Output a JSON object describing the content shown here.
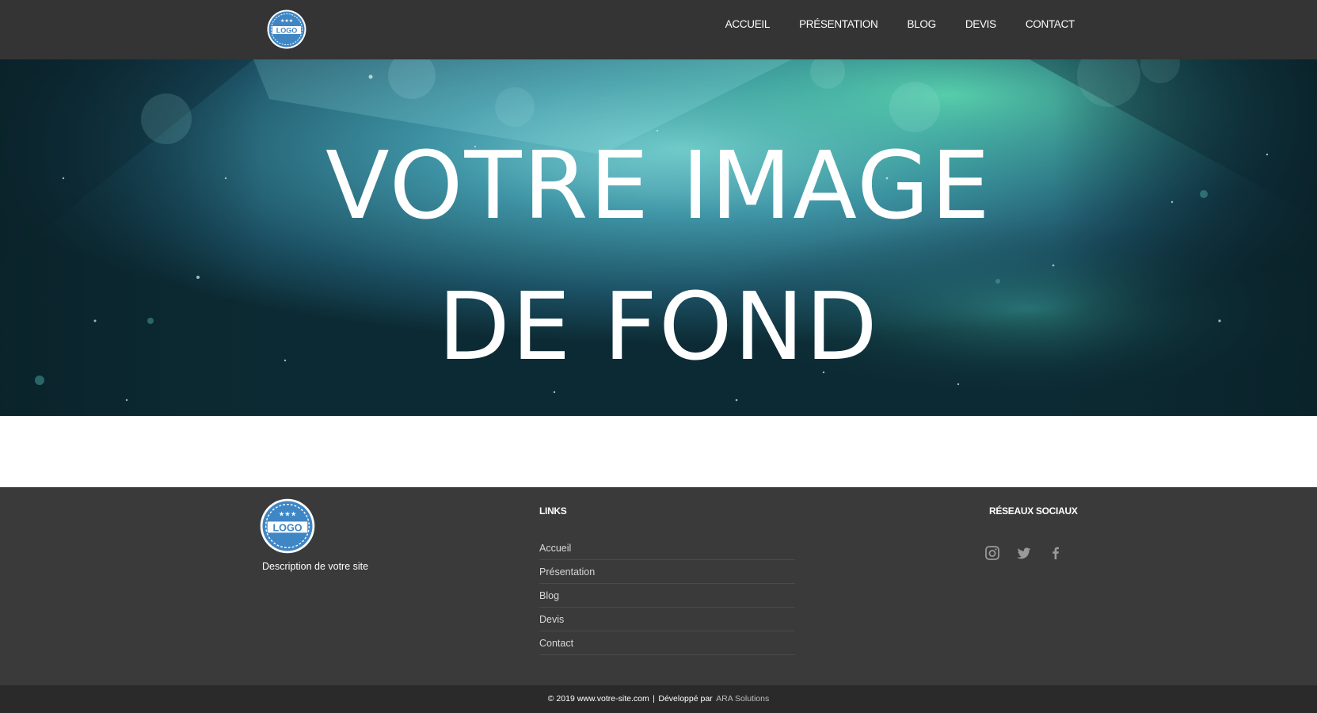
{
  "header": {
    "logo_text": "LOGO",
    "nav": [
      "ACCUEIL",
      "PRÉSENTATION",
      "BLOG",
      "DEVIS",
      "CONTACT"
    ]
  },
  "hero": {
    "line1": "VOTRE IMAGE",
    "line2": "DE FOND"
  },
  "footer": {
    "logo_text": "LOGO",
    "description": "Description de votre site",
    "links_heading": "LINKS",
    "links": [
      "Accueil",
      "Présentation",
      "Blog",
      "Devis",
      "Contact"
    ],
    "social_heading": "RÉSEAUX SOCIAUX",
    "social_icons": [
      "instagram-icon",
      "twitter-icon",
      "facebook-icon"
    ]
  },
  "bottom": {
    "copyright": "© 2019 www.votre-site.com",
    "separator": "|",
    "developed_by": "Développé par",
    "developer": "ARA Solutions"
  },
  "colors": {
    "header_bg": "#343434",
    "footer_bg": "#3a3a3a",
    "bottom_bg": "#2a2a2a",
    "logo_blue": "#3f86c4"
  }
}
